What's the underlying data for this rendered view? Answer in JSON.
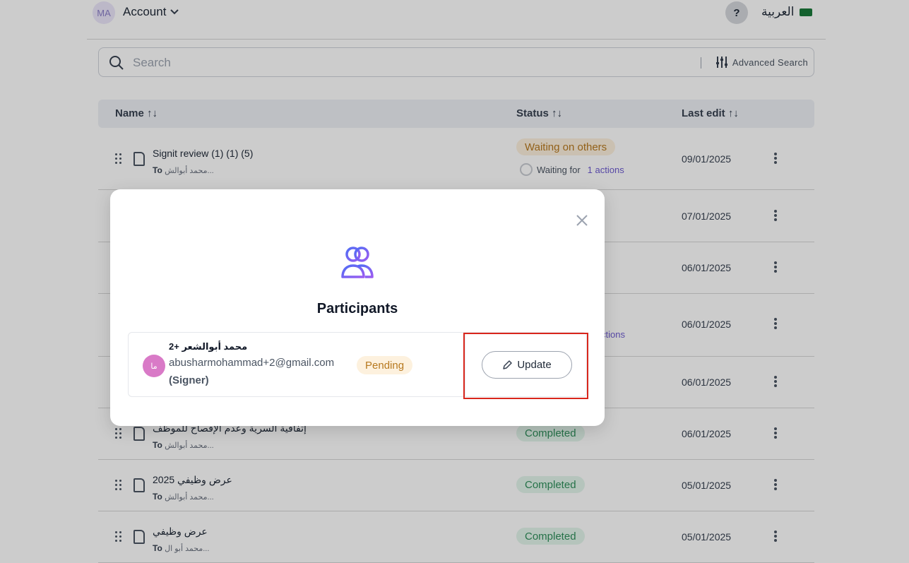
{
  "header": {
    "avatar_initials": "MA",
    "account_label": "Account",
    "help_label": "?",
    "language_label": "العربية"
  },
  "search": {
    "placeholder": "Search",
    "advanced_label": "Advanced Search"
  },
  "table": {
    "columns": [
      "Name",
      "Status",
      "Last edit"
    ],
    "rows": [
      {
        "title": "Signit review (1) (1) (5)",
        "to_prefix": "To",
        "to_name": "محمد أبوالش...",
        "status": "Waiting on others",
        "waiting_label": "Waiting for",
        "actions": "1 actions",
        "date": "09/01/2025"
      },
      {
        "title": "",
        "to_prefix": "",
        "to_name": "",
        "status": "",
        "date": "07/01/2025"
      },
      {
        "title": "",
        "to_prefix": "",
        "to_name": "",
        "status": "",
        "date": "06/01/2025"
      },
      {
        "title": "",
        "to_prefix": "",
        "to_name": "",
        "status_partial": "rs",
        "actions_partial": "ctions",
        "date": "06/01/2025"
      },
      {
        "title": "",
        "to_prefix": "",
        "to_name": "",
        "status": "",
        "date": "06/01/2025"
      },
      {
        "title": "إتفاقية السرية وعدم الإفصاح للموظف",
        "to_prefix": "To",
        "to_name": "محمد أبوالش...",
        "status": "Completed",
        "date": "06/01/2025"
      },
      {
        "title": "عرض وظيفي 2025",
        "to_prefix": "To",
        "to_name": "محمد أبوالش...",
        "status": "Completed",
        "date": "05/01/2025"
      },
      {
        "title": "عرض وظيفي",
        "to_prefix": "To",
        "to_name": "محمد أبو ال...",
        "status": "Completed",
        "date": "05/01/2025"
      }
    ]
  },
  "modal": {
    "title": "Participants",
    "participant": {
      "avatar_initials": "ما",
      "name": "محمد أبوالشعر +2",
      "email": "abusharmohammad+2@gmail.com",
      "role": "(Signer)",
      "status": "Pending"
    },
    "update_label": "Update"
  },
  "colors": {
    "accent": "#6d5bd0",
    "waiting_bg": "#fdf1de",
    "waiting_text": "#b7791f",
    "completed_bg": "#e3f5ec",
    "completed_text": "#2f8f5b",
    "highlight": "#d9261c"
  }
}
